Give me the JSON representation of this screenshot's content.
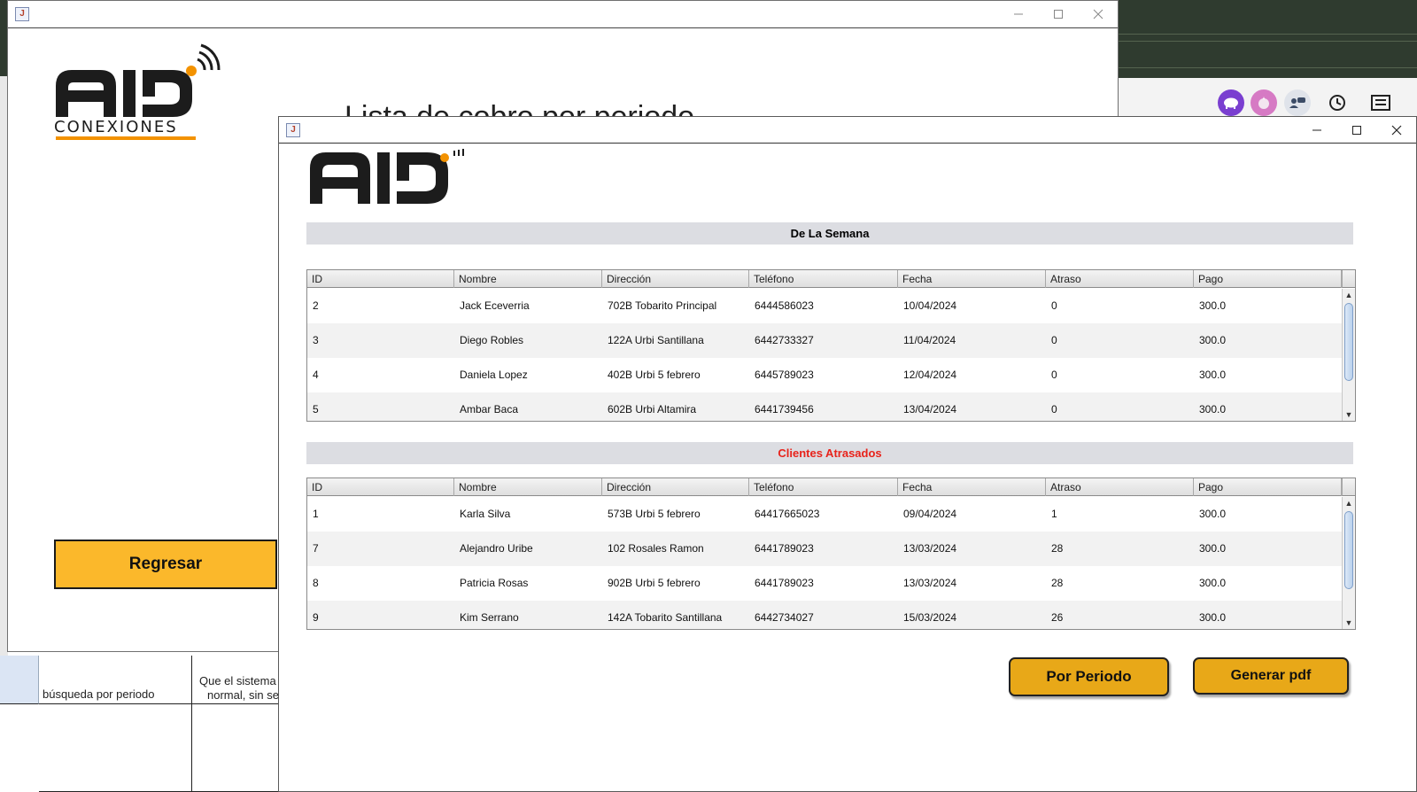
{
  "background": {
    "sheet_cells": [
      "búsqueda por periodo",
      "Que el sistema",
      "normal, sin se"
    ],
    "toolbar_icons": [
      "pig-icon",
      "onion-icon",
      "chat-bubble-icon",
      "history-icon",
      "list-icon"
    ]
  },
  "main_window": {
    "title": "",
    "headline": "Lista de cobro por periodo",
    "logo_text": "CONEXIONES",
    "regresar_label": "Regresar"
  },
  "report_window": {
    "title": "",
    "weekly": {
      "heading": "De La Semana",
      "columns": [
        "ID",
        "Nombre",
        "Dirección",
        "Teléfono",
        "Fecha",
        "Atraso",
        "Pago"
      ],
      "rows": [
        [
          "2",
          "Jack Eceverria",
          "702B Tobarito Principal",
          "6444586023",
          "10/04/2024",
          "0",
          "300.0"
        ],
        [
          "3",
          "Diego Robles",
          "122A Urbi Santillana",
          "6442733327",
          "11/04/2024",
          "0",
          "300.0"
        ],
        [
          "4",
          "Daniela Lopez",
          "402B Urbi 5 febrero",
          "6445789023",
          "12/04/2024",
          "0",
          "300.0"
        ],
        [
          "5",
          "Ambar Baca",
          "602B Urbi Altamira",
          "6441739456",
          "13/04/2024",
          "0",
          "300.0"
        ]
      ]
    },
    "late": {
      "heading": "Clientes Atrasados",
      "heading_color": "#e8231b",
      "columns": [
        "ID",
        "Nombre",
        "Dirección",
        "Teléfono",
        "Fecha",
        "Atraso",
        "Pago"
      ],
      "rows": [
        [
          "1",
          "Karla Silva",
          "573B Urbi 5 febrero",
          "64417665023",
          "09/04/2024",
          "1",
          "300.0"
        ],
        [
          "7",
          "Alejandro Uribe",
          "102 Rosales Ramon",
          "6441789023",
          "13/03/2024",
          "28",
          "300.0"
        ],
        [
          "8",
          "Patricia Rosas",
          "902B Urbi 5 febrero",
          "6441789023",
          "13/03/2024",
          "28",
          "300.0"
        ],
        [
          "9",
          "Kim Serrano",
          "142A Tobarito Santillana",
          "6442734027",
          "15/03/2024",
          "26",
          "300.0"
        ]
      ]
    },
    "por_periodo_label": "Por Periodo",
    "generar_pdf_label": "Generar pdf"
  },
  "colors": {
    "accent_gold": "#e8a818",
    "regresar_gold": "#fbb82b",
    "logo_orange": "#f39200"
  }
}
